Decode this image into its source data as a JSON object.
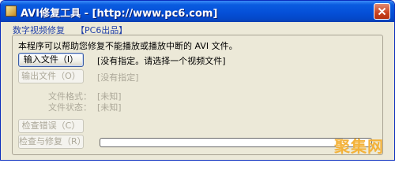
{
  "window": {
    "title": "AVI修复工具 - [http://www.pc6.com]",
    "title_bar_color": "#0550d8"
  },
  "tabs": [
    {
      "label": "数字视频修复"
    },
    {
      "label": "【PC6出品】"
    }
  ],
  "description": "本程序可以帮助您修复不能播放或播放中断的 AVI 文件。",
  "input_file": {
    "button_label": "输入文件（I）",
    "value": "[没有指定。请选择一个视频文件]"
  },
  "output_file": {
    "button_label": "输出文件（O）",
    "value": "[没有指定]"
  },
  "file_format": {
    "label": "文件格式：",
    "value": "[未知]"
  },
  "file_status": {
    "label": "文件状态：",
    "value": "[未知]"
  },
  "check_errors": {
    "button_label": "检查错误（C）"
  },
  "check_repair": {
    "button_label": "检查与修复（R）"
  },
  "progress": {
    "value": 0
  },
  "watermark": "聚集网",
  "icons": {
    "app": "app-icon",
    "close": "close-icon"
  },
  "colors": {
    "tab_label": "#1f3fa8",
    "disabled_text": "#aca899",
    "watermark": "#f3b23a"
  }
}
